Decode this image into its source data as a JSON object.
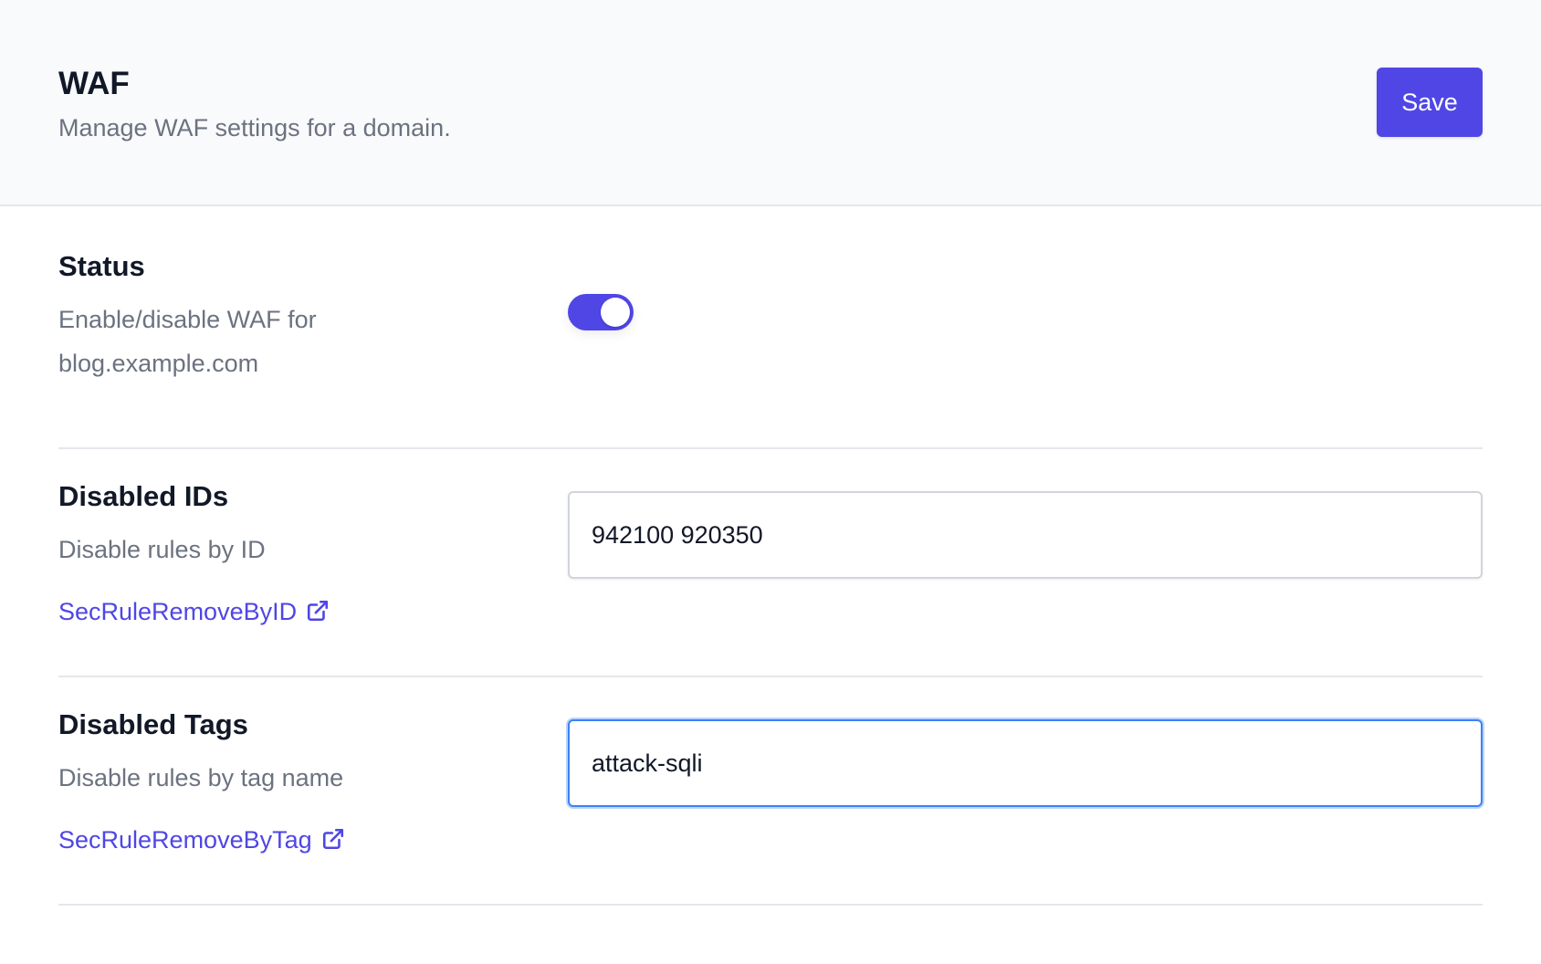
{
  "header": {
    "title": "WAF",
    "subtitle": "Manage WAF settings for a domain.",
    "save_label": "Save",
    "accent_color": "#4f46e5"
  },
  "sections": {
    "status": {
      "title": "Status",
      "description": "Enable/disable WAF for blog.example.com",
      "toggle_enabled": true
    },
    "disabled_ids": {
      "title": "Disabled IDs",
      "description": "Disable rules by ID",
      "link_label": "SecRuleRemoveByID",
      "link_icon": "external-link-icon",
      "input_value": "942100 920350"
    },
    "disabled_tags": {
      "title": "Disabled Tags",
      "description": "Disable rules by tag name",
      "link_label": "SecRuleRemoveByTag",
      "link_icon": "external-link-icon",
      "input_value": "attack-sqli",
      "input_focused": true
    }
  }
}
